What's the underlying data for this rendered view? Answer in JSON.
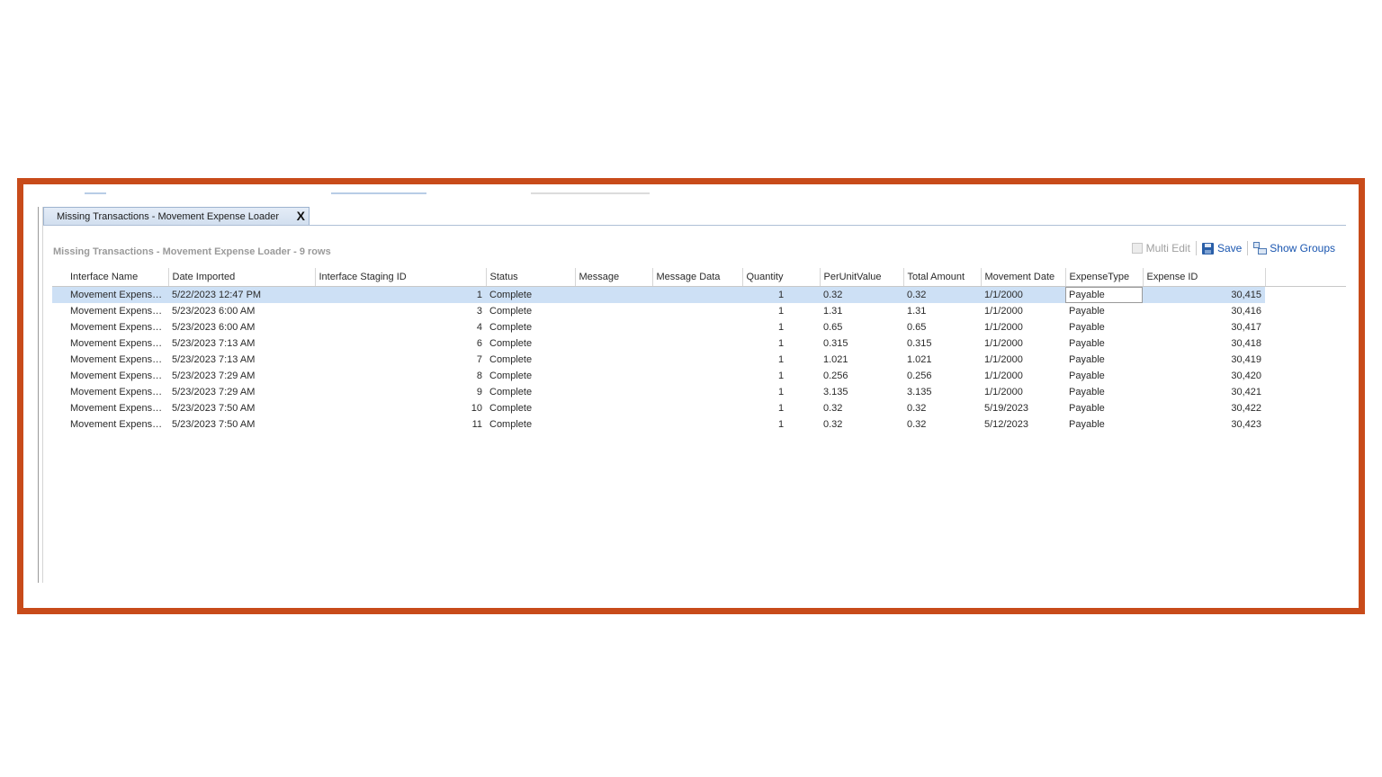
{
  "tab": {
    "label": "Missing Transactions - Movement Expense Loader",
    "close_label": "X"
  },
  "grid_title": "Missing Transactions - Movement Expense Loader - 9 rows",
  "toolbar": {
    "multi_edit": "Multi Edit",
    "save": "Save",
    "show_groups": "Show Groups"
  },
  "columns": [
    "Interface Name",
    "Date Imported",
    "Interface Staging ID",
    "Status",
    "Message",
    "Message Data",
    "Quantity",
    "PerUnitValue",
    "Total Amount",
    "Movement Date",
    "ExpenseType",
    "Expense ID"
  ],
  "rows": [
    [
      "Movement Expense...",
      "5/22/2023 12:47 PM",
      "1",
      "Complete",
      "",
      "",
      "1",
      "0.32",
      "0.32",
      "1/1/2000",
      "Payable",
      "30,415"
    ],
    [
      "Movement Expense...",
      "5/23/2023 6:00 AM",
      "3",
      "Complete",
      "",
      "",
      "1",
      "1.31",
      "1.31",
      "1/1/2000",
      "Payable",
      "30,416"
    ],
    [
      "Movement Expense...",
      "5/23/2023 6:00 AM",
      "4",
      "Complete",
      "",
      "",
      "1",
      "0.65",
      "0.65",
      "1/1/2000",
      "Payable",
      "30,417"
    ],
    [
      "Movement Expense...",
      "5/23/2023 7:13 AM",
      "6",
      "Complete",
      "",
      "",
      "1",
      "0.315",
      "0.315",
      "1/1/2000",
      "Payable",
      "30,418"
    ],
    [
      "Movement Expense...",
      "5/23/2023 7:13 AM",
      "7",
      "Complete",
      "",
      "",
      "1",
      "1.021",
      "1.021",
      "1/1/2000",
      "Payable",
      "30,419"
    ],
    [
      "Movement Expense...",
      "5/23/2023 7:29 AM",
      "8",
      "Complete",
      "",
      "",
      "1",
      "0.256",
      "0.256",
      "1/1/2000",
      "Payable",
      "30,420"
    ],
    [
      "Movement Expense...",
      "5/23/2023 7:29 AM",
      "9",
      "Complete",
      "",
      "",
      "1",
      "3.135",
      "3.135",
      "1/1/2000",
      "Payable",
      "30,421"
    ],
    [
      "Movement Expense...",
      "5/23/2023 7:50 AM",
      "10",
      "Complete",
      "",
      "",
      "1",
      "0.32",
      "0.32",
      "5/19/2023",
      "Payable",
      "30,422"
    ],
    [
      "Movement Expense...",
      "5/23/2023 7:50 AM",
      "11",
      "Complete",
      "",
      "",
      "1",
      "0.32",
      "0.32",
      "5/12/2023",
      "Payable",
      "30,423"
    ]
  ],
  "colors": {
    "frame_border": "#c84b1a",
    "selected_row": "#cde0f5",
    "link_blue": "#1a56b0"
  },
  "icons": {
    "save": "save-icon",
    "show_groups": "show-groups-icon",
    "close": "close-icon"
  }
}
